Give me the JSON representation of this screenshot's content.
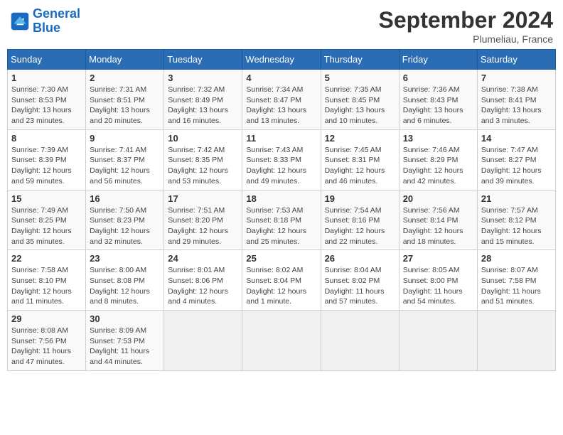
{
  "logo": {
    "line1": "General",
    "line2": "Blue"
  },
  "title": "September 2024",
  "location": "Plumeliau, France",
  "days_of_week": [
    "Sunday",
    "Monday",
    "Tuesday",
    "Wednesday",
    "Thursday",
    "Friday",
    "Saturday"
  ],
  "weeks": [
    [
      {
        "day": "1",
        "text": "Sunrise: 7:30 AM\nSunset: 8:53 PM\nDaylight: 13 hours\nand 23 minutes."
      },
      {
        "day": "2",
        "text": "Sunrise: 7:31 AM\nSunset: 8:51 PM\nDaylight: 13 hours\nand 20 minutes."
      },
      {
        "day": "3",
        "text": "Sunrise: 7:32 AM\nSunset: 8:49 PM\nDaylight: 13 hours\nand 16 minutes."
      },
      {
        "day": "4",
        "text": "Sunrise: 7:34 AM\nSunset: 8:47 PM\nDaylight: 13 hours\nand 13 minutes."
      },
      {
        "day": "5",
        "text": "Sunrise: 7:35 AM\nSunset: 8:45 PM\nDaylight: 13 hours\nand 10 minutes."
      },
      {
        "day": "6",
        "text": "Sunrise: 7:36 AM\nSunset: 8:43 PM\nDaylight: 13 hours\nand 6 minutes."
      },
      {
        "day": "7",
        "text": "Sunrise: 7:38 AM\nSunset: 8:41 PM\nDaylight: 13 hours\nand 3 minutes."
      }
    ],
    [
      {
        "day": "8",
        "text": "Sunrise: 7:39 AM\nSunset: 8:39 PM\nDaylight: 12 hours\nand 59 minutes."
      },
      {
        "day": "9",
        "text": "Sunrise: 7:41 AM\nSunset: 8:37 PM\nDaylight: 12 hours\nand 56 minutes."
      },
      {
        "day": "10",
        "text": "Sunrise: 7:42 AM\nSunset: 8:35 PM\nDaylight: 12 hours\nand 53 minutes."
      },
      {
        "day": "11",
        "text": "Sunrise: 7:43 AM\nSunset: 8:33 PM\nDaylight: 12 hours\nand 49 minutes."
      },
      {
        "day": "12",
        "text": "Sunrise: 7:45 AM\nSunset: 8:31 PM\nDaylight: 12 hours\nand 46 minutes."
      },
      {
        "day": "13",
        "text": "Sunrise: 7:46 AM\nSunset: 8:29 PM\nDaylight: 12 hours\nand 42 minutes."
      },
      {
        "day": "14",
        "text": "Sunrise: 7:47 AM\nSunset: 8:27 PM\nDaylight: 12 hours\nand 39 minutes."
      }
    ],
    [
      {
        "day": "15",
        "text": "Sunrise: 7:49 AM\nSunset: 8:25 PM\nDaylight: 12 hours\nand 35 minutes."
      },
      {
        "day": "16",
        "text": "Sunrise: 7:50 AM\nSunset: 8:23 PM\nDaylight: 12 hours\nand 32 minutes."
      },
      {
        "day": "17",
        "text": "Sunrise: 7:51 AM\nSunset: 8:20 PM\nDaylight: 12 hours\nand 29 minutes."
      },
      {
        "day": "18",
        "text": "Sunrise: 7:53 AM\nSunset: 8:18 PM\nDaylight: 12 hours\nand 25 minutes."
      },
      {
        "day": "19",
        "text": "Sunrise: 7:54 AM\nSunset: 8:16 PM\nDaylight: 12 hours\nand 22 minutes."
      },
      {
        "day": "20",
        "text": "Sunrise: 7:56 AM\nSunset: 8:14 PM\nDaylight: 12 hours\nand 18 minutes."
      },
      {
        "day": "21",
        "text": "Sunrise: 7:57 AM\nSunset: 8:12 PM\nDaylight: 12 hours\nand 15 minutes."
      }
    ],
    [
      {
        "day": "22",
        "text": "Sunrise: 7:58 AM\nSunset: 8:10 PM\nDaylight: 12 hours\nand 11 minutes."
      },
      {
        "day": "23",
        "text": "Sunrise: 8:00 AM\nSunset: 8:08 PM\nDaylight: 12 hours\nand 8 minutes."
      },
      {
        "day": "24",
        "text": "Sunrise: 8:01 AM\nSunset: 8:06 PM\nDaylight: 12 hours\nand 4 minutes."
      },
      {
        "day": "25",
        "text": "Sunrise: 8:02 AM\nSunset: 8:04 PM\nDaylight: 12 hours\nand 1 minute."
      },
      {
        "day": "26",
        "text": "Sunrise: 8:04 AM\nSunset: 8:02 PM\nDaylight: 11 hours\nand 57 minutes."
      },
      {
        "day": "27",
        "text": "Sunrise: 8:05 AM\nSunset: 8:00 PM\nDaylight: 11 hours\nand 54 minutes."
      },
      {
        "day": "28",
        "text": "Sunrise: 8:07 AM\nSunset: 7:58 PM\nDaylight: 11 hours\nand 51 minutes."
      }
    ],
    [
      {
        "day": "29",
        "text": "Sunrise: 8:08 AM\nSunset: 7:56 PM\nDaylight: 11 hours\nand 47 minutes."
      },
      {
        "day": "30",
        "text": "Sunrise: 8:09 AM\nSunset: 7:53 PM\nDaylight: 11 hours\nand 44 minutes."
      },
      {
        "day": "",
        "text": ""
      },
      {
        "day": "",
        "text": ""
      },
      {
        "day": "",
        "text": ""
      },
      {
        "day": "",
        "text": ""
      },
      {
        "day": "",
        "text": ""
      }
    ]
  ]
}
